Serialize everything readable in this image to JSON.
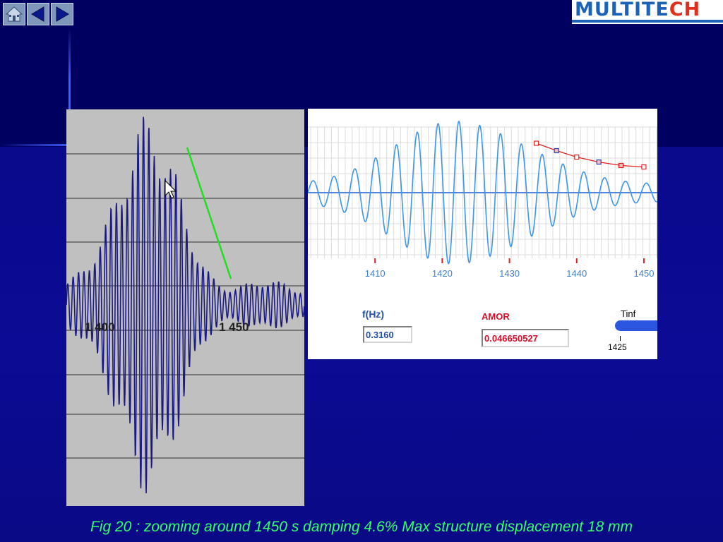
{
  "logo": {
    "part1": "MULTITE",
    "part2": "CH"
  },
  "nav": {
    "home_icon": "home-icon",
    "back_icon": "triangle-left-icon",
    "forward_icon": "triangle-right-icon"
  },
  "left_chart": {
    "tick_labels": [
      "1 400",
      "1 450"
    ]
  },
  "right_chart": {
    "x_ticks": [
      "1410",
      "1420",
      "1430",
      "1440",
      "1450"
    ]
  },
  "controls": {
    "frequency_label": "f(Hz)",
    "frequency_value": "0.3160",
    "damping_label": "AMOR",
    "damping_value": "0.046650527",
    "slider_label": "Tinf",
    "slider_value": "1425"
  },
  "caption": "Fig 20 : zooming around 1450 s  damping 4.6% Max structure displacement 18 mm",
  "colors": {
    "background": "#000066",
    "caption": "#33ff66",
    "signal_dark": "#1a1a80",
    "signal_light": "#3d96e8",
    "envelope": "#e02020",
    "trend_line": "#22dd22"
  },
  "chart_data": [
    {
      "type": "line",
      "x": [
        1377,
        1450,
        1465
      ],
      "xticks": [
        1400,
        1450
      ],
      "tick_labels": [
        "1 400",
        "1 450"
      ],
      "series": [
        {
          "values": [],
          "note_peak_times": [
            1397,
            1451
          ]
        }
      ],
      "grid": true
    },
    {
      "type": "line",
      "xlim": [
        1400,
        1452
      ],
      "xticks": [
        1410,
        1420,
        1430,
        1440,
        1450
      ],
      "series": [
        {
          "x": [
            1434,
            1437,
            1440,
            1443.3,
            1446.6,
            1450
          ],
          "values": [
            1.0,
            0.85,
            0.72,
            0.62,
            0.55,
            0.52
          ]
        }
      ],
      "grid": true
    }
  ]
}
